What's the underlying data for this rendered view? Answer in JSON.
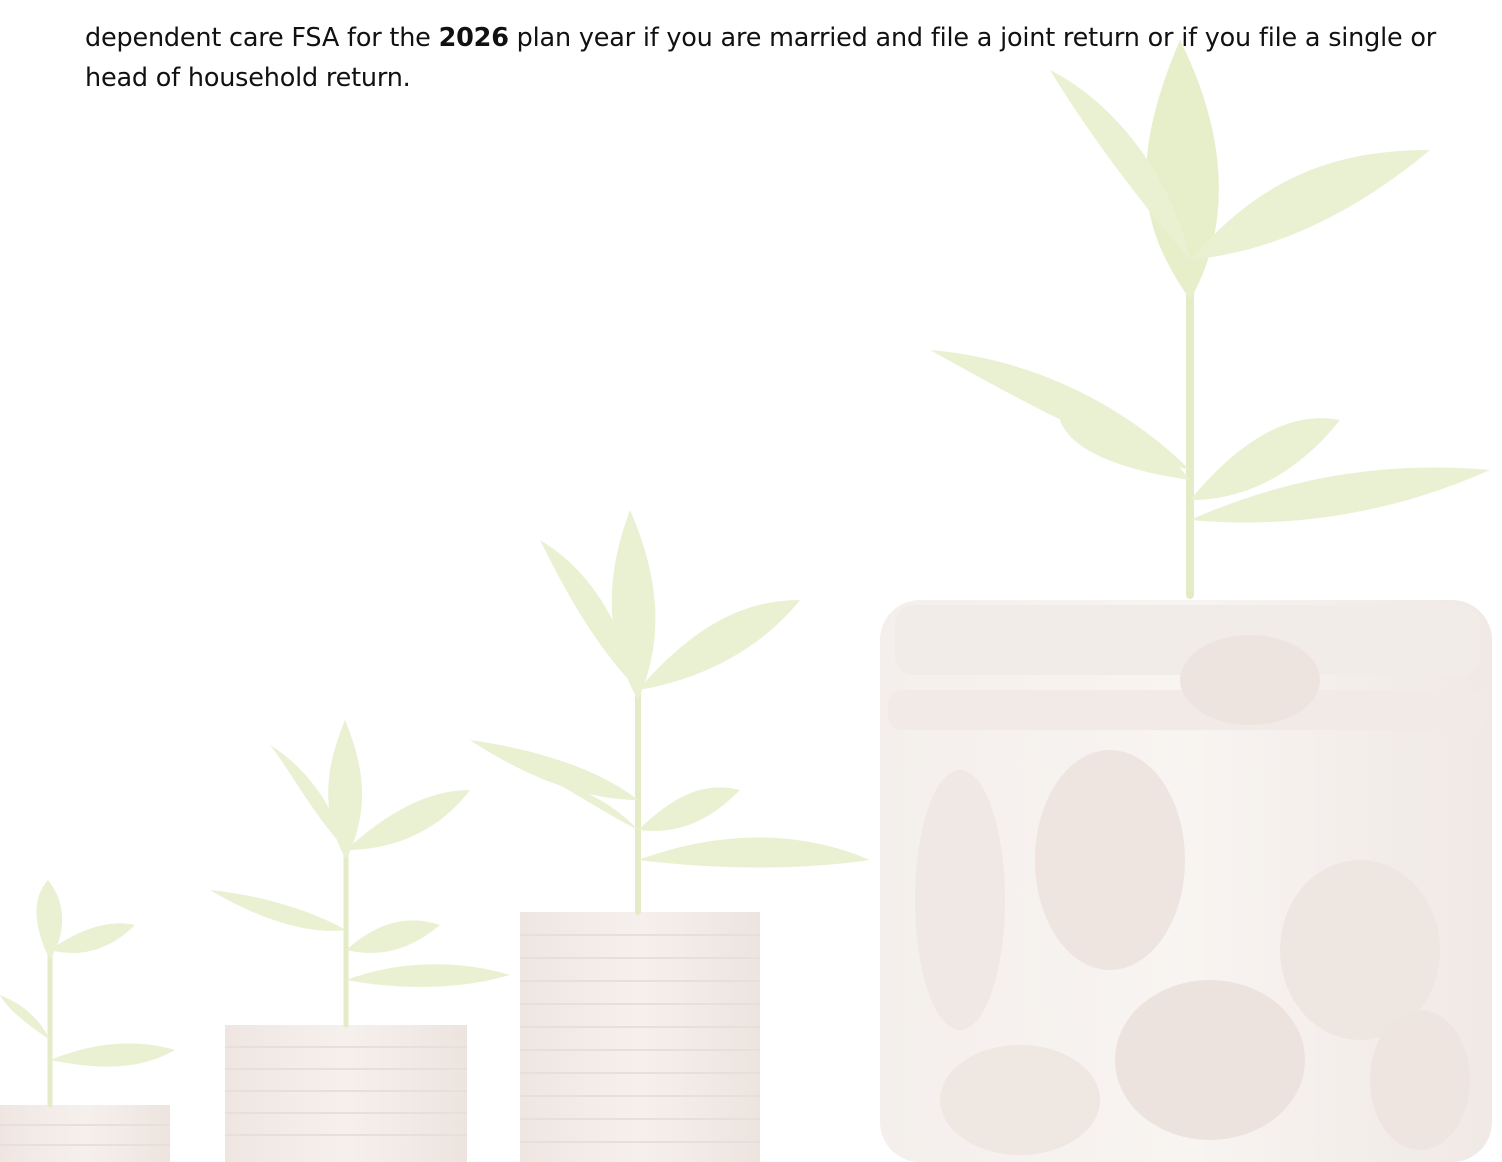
{
  "content": {
    "paragraph": {
      "before_year": "dependent care FSA for the",
      "year": "2026",
      "after_year": "plan year if you are married and file a joint return or if you file a single or head of household return."
    }
  },
  "colors": {
    "text": "#111111",
    "background": "#ffffff",
    "leaf_green": "#e8f0cc",
    "coin_tint": "#f3ece8"
  },
  "background_image": {
    "icon": "coin-stacks-with-seedlings-and-coin-jar-watermark"
  }
}
